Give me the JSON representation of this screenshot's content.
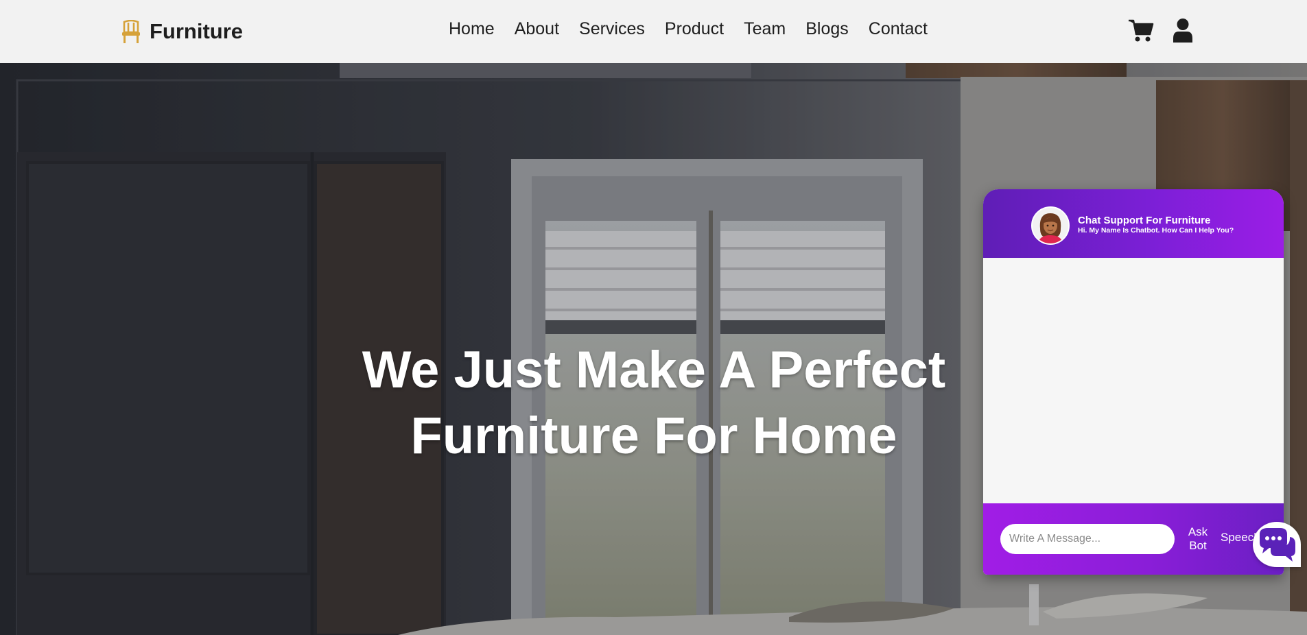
{
  "header": {
    "logo_text": "Furniture",
    "logo_icon": "chair-icon",
    "nav": [
      "Home",
      "About",
      "Services",
      "Product",
      "Team",
      "Blogs",
      "Contact"
    ],
    "icons": [
      "shopping-cart-icon",
      "user-icon"
    ]
  },
  "hero": {
    "title_line1": "We Just Make A Perfect",
    "title_line2": "Furniture For Home"
  },
  "chat": {
    "title": "Chat Support For Furniture",
    "subtitle": "Hi. My Name Is Chatbot. How Can I Help You?",
    "input_placeholder": "Write A Message...",
    "ask_line1": "Ask",
    "ask_line2": "Bot",
    "speech_label": "Speech",
    "launcher_icon": "chat-bubbles-icon"
  },
  "colors": {
    "accent_logo": "#d6a23a",
    "chat_purple_dark": "#5f1eb6",
    "chat_purple_light": "#a11de6",
    "header_bg": "#f2f2f2"
  }
}
